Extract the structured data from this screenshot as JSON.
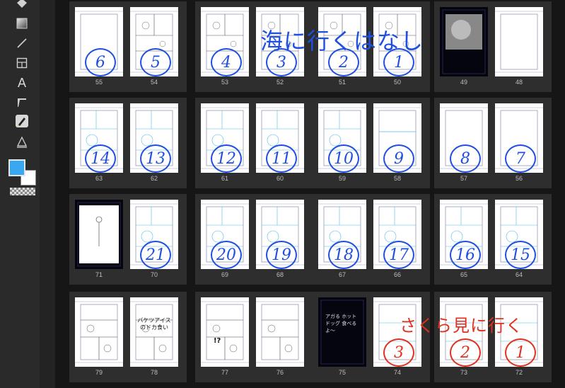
{
  "colors": {
    "foreground": "#3aa7f2",
    "background": "#ffffff",
    "ink_blue": "#1f4fe0",
    "ink_red": "#e2301f",
    "sketch_blue": "#4fb9e8"
  },
  "toolbar": {
    "tools": [
      {
        "name": "fill-icon"
      },
      {
        "name": "gradient-icon"
      },
      {
        "name": "line-icon"
      },
      {
        "name": "frame-border-icon"
      },
      {
        "name": "text-tool-icon",
        "glyph": "A"
      },
      {
        "name": "balloon-tail-icon"
      },
      {
        "name": "pen-tool-icon"
      },
      {
        "name": "perspective-ruler-icon"
      }
    ]
  },
  "annotations": {
    "chapter1": "海に行くはなし",
    "chapter2": "さくら見に行く"
  },
  "rows": [
    {
      "pages": [
        {
          "num": "55",
          "circle": "6",
          "color": "blue"
        },
        {
          "num": "54",
          "circle": "5",
          "color": "blue"
        },
        {
          "num": "53",
          "circle": "4",
          "color": "blue"
        },
        {
          "num": "52",
          "circle": "3",
          "color": "blue"
        },
        {
          "num": "51",
          "circle": "2",
          "color": "blue"
        },
        {
          "num": "50",
          "circle": "1",
          "color": "blue"
        },
        {
          "num": "49",
          "circle": "",
          "color": "blue"
        },
        {
          "num": "48",
          "circle": "",
          "color": "blue"
        }
      ]
    },
    {
      "pages": [
        {
          "num": "63",
          "circle": "14",
          "color": "blue"
        },
        {
          "num": "62",
          "circle": "13",
          "color": "blue"
        },
        {
          "num": "61",
          "circle": "12",
          "color": "blue"
        },
        {
          "num": "60",
          "circle": "11",
          "color": "blue"
        },
        {
          "num": "59",
          "circle": "10",
          "color": "blue"
        },
        {
          "num": "58",
          "circle": "9",
          "color": "blue"
        },
        {
          "num": "57",
          "circle": "8",
          "color": "blue"
        },
        {
          "num": "56",
          "circle": "7",
          "color": "blue"
        }
      ]
    },
    {
      "pages": [
        {
          "num": "71",
          "circle": "",
          "color": "blue"
        },
        {
          "num": "70",
          "circle": "21",
          "color": "blue"
        },
        {
          "num": "69",
          "circle": "20",
          "color": "blue"
        },
        {
          "num": "68",
          "circle": "19",
          "color": "blue"
        },
        {
          "num": "67",
          "circle": "18",
          "color": "blue"
        },
        {
          "num": "66",
          "circle": "17",
          "color": "blue"
        },
        {
          "num": "65",
          "circle": "16",
          "color": "blue"
        },
        {
          "num": "64",
          "circle": "15",
          "color": "blue"
        }
      ]
    },
    {
      "pages": [
        {
          "num": "79",
          "circle": "",
          "color": "red"
        },
        {
          "num": "78",
          "circle": "",
          "color": "red",
          "title": "バケツアイスのドカ食い"
        },
        {
          "num": "77",
          "circle": "",
          "color": "red",
          "mark": "!?"
        },
        {
          "num": "76",
          "circle": "",
          "color": "red"
        },
        {
          "num": "75",
          "circle": "",
          "color": "red",
          "dark_text": "アガる ホットドッグ 食べるよ〜"
        },
        {
          "num": "74",
          "circle": "3",
          "color": "red"
        },
        {
          "num": "73",
          "circle": "2",
          "color": "red"
        },
        {
          "num": "72",
          "circle": "1",
          "color": "red"
        }
      ]
    }
  ]
}
